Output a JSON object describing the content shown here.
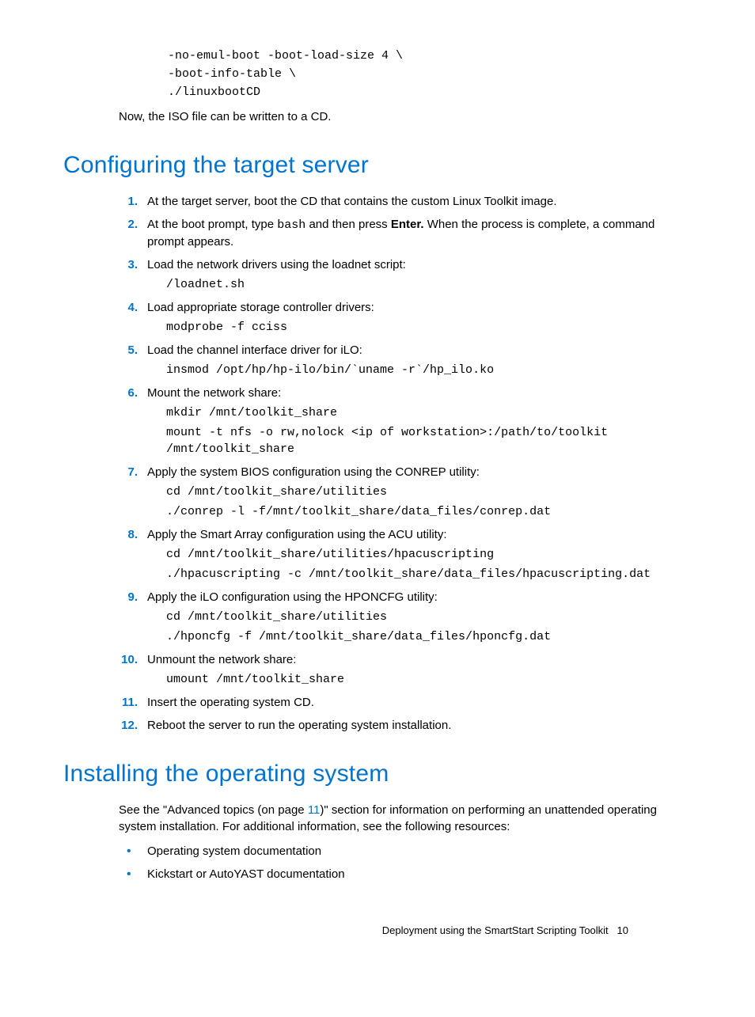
{
  "topCode": {
    "l1": "-no-emul-boot -boot-load-size 4 \\",
    "l2": "-boot-info-table \\",
    "l3": "./linuxbootCD"
  },
  "isoNote": "Now, the ISO file can be written to a CD.",
  "h1a": "Configuring the target server",
  "steps": {
    "s1": "At the target server, boot the CD that contains the custom Linux Toolkit image.",
    "s2a": "At the boot prompt, type ",
    "s2code": "bash",
    "s2b": " and then press ",
    "s2bold": "Enter.",
    "s2c": " When the process is complete, a command prompt appears.",
    "s3": "Load the network drivers using the loadnet script:",
    "s3code": "/loadnet.sh",
    "s4": "Load appropriate storage controller drivers:",
    "s4code": "modprobe -f cciss",
    "s5": "Load the channel interface driver for iLO:",
    "s5code": "insmod /opt/hp/hp-ilo/bin/`uname -r`/hp_ilo.ko",
    "s6": "Mount the network share:",
    "s6code1": "mkdir /mnt/toolkit_share",
    "s6code2": "mount -t nfs -o rw,nolock <ip of workstation>:/path/to/toolkit /mnt/toolkit_share",
    "s7": "Apply the system BIOS configuration using the CONREP utility:",
    "s7code1": "cd /mnt/toolkit_share/utilities",
    "s7code2": "./conrep -l -f/mnt/toolkit_share/data_files/conrep.dat",
    "s8": "Apply the Smart Array configuration using the ACU utility:",
    "s8code1": "cd /mnt/toolkit_share/utilities/hpacuscripting",
    "s8code2": "./hpacuscripting -c /mnt/toolkit_share/data_files/hpacuscripting.dat",
    "s9": "Apply the iLO configuration using the HPONCFG utility:",
    "s9code1": "cd /mnt/toolkit_share/utilities",
    "s9code2": "./hponcfg -f /mnt/toolkit_share/data_files/hponcfg.dat",
    "s10": "Unmount the network share:",
    "s10code": "umount /mnt/toolkit_share",
    "s11": "Insert the operating system CD.",
    "s12": "Reboot the server to run the operating system installation."
  },
  "h1b": "Installing the operating system",
  "install": {
    "p1a": "See the \"Advanced topics (on page ",
    "link": "11",
    "p1b": ")\" section for information on performing an unattended operating system installation. For additional information, see the following resources:",
    "b1": "Operating system documentation",
    "b2": "Kickstart or AutoYAST documentation"
  },
  "footer": {
    "text": "Deployment using the SmartStart Scripting Toolkit",
    "page": "10"
  }
}
